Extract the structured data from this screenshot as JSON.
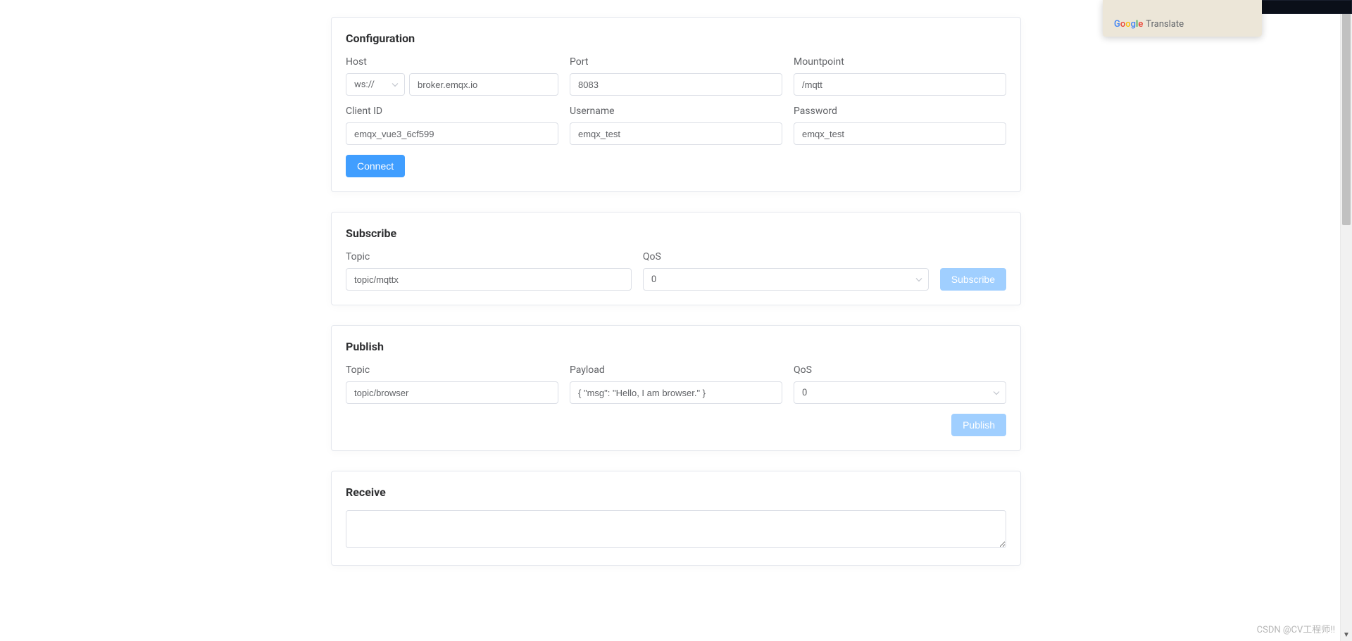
{
  "gtranslate": {
    "logo_text": "Google",
    "translate_text": "Translate"
  },
  "configuration": {
    "title": "Configuration",
    "host_label": "Host",
    "protocol_value": "ws://",
    "host_value": "broker.emqx.io",
    "port_label": "Port",
    "port_value": "8083",
    "mountpoint_label": "Mountpoint",
    "mountpoint_value": "/mqtt",
    "clientid_label": "Client ID",
    "clientid_value": "emqx_vue3_6cf599",
    "username_label": "Username",
    "username_value": "emqx_test",
    "password_label": "Password",
    "password_value": "emqx_test",
    "connect_button": "Connect"
  },
  "subscribe": {
    "title": "Subscribe",
    "topic_label": "Topic",
    "topic_value": "topic/mqttx",
    "qos_label": "QoS",
    "qos_value": "0",
    "subscribe_button": "Subscribe"
  },
  "publish": {
    "title": "Publish",
    "topic_label": "Topic",
    "topic_value": "topic/browser",
    "payload_label": "Payload",
    "payload_value": "{ \"msg\": \"Hello, I am browser.\" }",
    "qos_label": "QoS",
    "qos_value": "0",
    "publish_button": "Publish"
  },
  "receive": {
    "title": "Receive",
    "content": ""
  },
  "watermark": "CSDN @CV工程师!!"
}
